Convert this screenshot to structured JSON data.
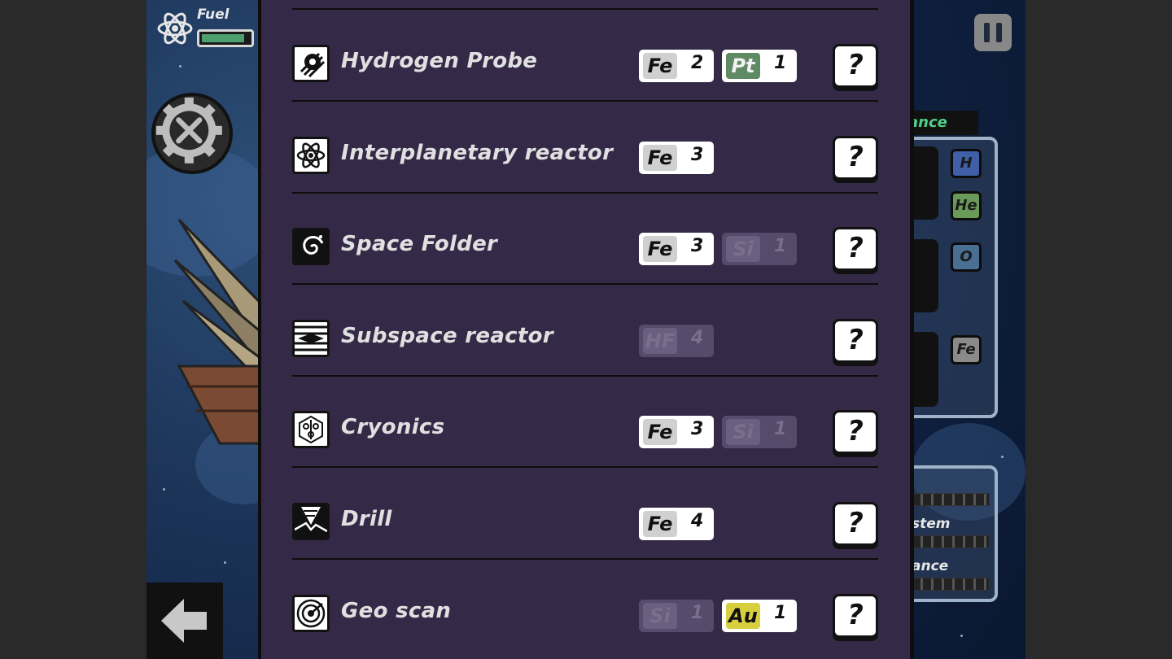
{
  "hud": {
    "fuel_label": "Fuel",
    "fuel_level_pct": 90,
    "icons": {
      "fuel": "atom-icon",
      "build": "gear-tools-icon",
      "back": "back-arrow-icon",
      "pause": "pause-icon"
    }
  },
  "side_panel": {
    "label_fragment": "ance",
    "elements": [
      "H",
      "He",
      "O",
      "Fe"
    ],
    "element_colors": {
      "H": "#3f5fa8",
      "He": "#6a9a5a",
      "O": "#4a6f95",
      "Fe": "#8a8a8a"
    },
    "stats": [
      "stem",
      "ance"
    ]
  },
  "items": [
    {
      "name": "Hydrogen Probe",
      "icon": "hydrogen-probe-icon",
      "costs": [
        {
          "sym": "Fe",
          "qty": "2",
          "state": "available"
        },
        {
          "sym": "Pt",
          "qty": "1",
          "state": "available"
        }
      ]
    },
    {
      "name": "Interplanetary reactor",
      "icon": "atom-reactor-icon",
      "costs": [
        {
          "sym": "Fe",
          "qty": "3",
          "state": "available"
        }
      ]
    },
    {
      "name": "Space Folder",
      "icon": "spiral-vortex-icon",
      "costs": [
        {
          "sym": "Fe",
          "qty": "3",
          "state": "available"
        },
        {
          "sym": "Si",
          "qty": "1",
          "state": "missing"
        }
      ]
    },
    {
      "name": "Subspace reactor",
      "icon": "subspace-lines-icon",
      "costs": [
        {
          "sym": "HF",
          "qty": "4",
          "state": "missing"
        }
      ]
    },
    {
      "name": "Cryonics",
      "icon": "snowflake-crystal-icon",
      "costs": [
        {
          "sym": "Fe",
          "qty": "3",
          "state": "available"
        },
        {
          "sym": "Si",
          "qty": "1",
          "state": "missing"
        }
      ]
    },
    {
      "name": "Drill",
      "icon": "drill-icon",
      "costs": [
        {
          "sym": "Fe",
          "qty": "4",
          "state": "available"
        }
      ]
    },
    {
      "name": "Geo scan",
      "icon": "radar-scan-icon",
      "costs": [
        {
          "sym": "Si",
          "qty": "1",
          "state": "missing"
        },
        {
          "sym": "Au",
          "qty": "1",
          "state": "available"
        }
      ]
    }
  ],
  "help_label": "?"
}
